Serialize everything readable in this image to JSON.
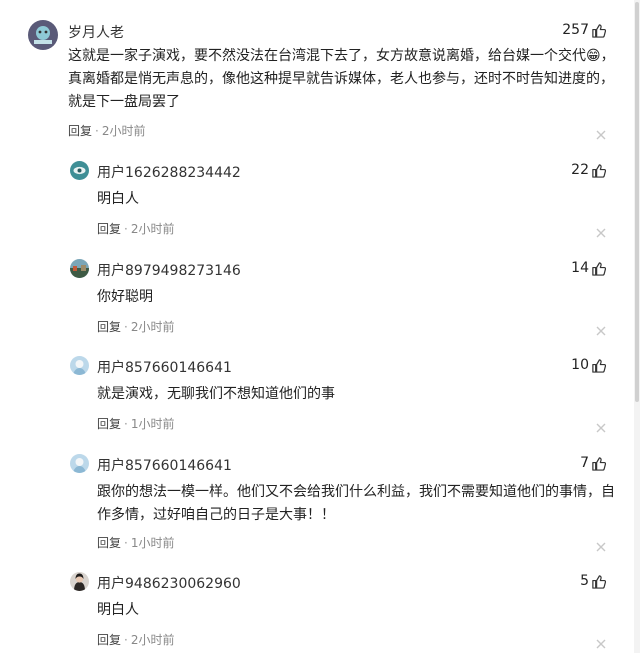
{
  "comments": [
    {
      "user": "岁月人老",
      "likes": "257",
      "content": "这就是一家子演戏，要不然没法在台湾混下去了，女方故意说离婚，给台媒一个交代😁，真离婚都是悄无声息的，像他这种提早就告诉媒体，老人也参与，还时不时告知进度的，就是下一盘局罢了",
      "reply_label": "回复",
      "time": "2小时前"
    },
    {
      "user": "用户1626288234442",
      "likes": "22",
      "content": "明白人",
      "reply_label": "回复",
      "time": "2小时前"
    },
    {
      "user": "用户8979498273146",
      "likes": "14",
      "content": "你好聪明",
      "reply_label": "回复",
      "time": "2小时前"
    },
    {
      "user": "用户857660146641",
      "likes": "10",
      "content": "就是演戏，无聊我们不想知道他们的事",
      "reply_label": "回复",
      "time": "1小时前"
    },
    {
      "user": "用户857660146641",
      "likes": "7",
      "content": "跟你的想法一模一样。他们又不会给我们什么利益，我们不需要知道他们的事情，自作多情，过好咱自己的日子是大事！！",
      "reply_label": "回复",
      "time": "1小时前"
    },
    {
      "user": "用户9486230062960",
      "likes": "5",
      "content": "明白人",
      "reply_label": "回复",
      "time": "2小时前"
    }
  ],
  "icons": {
    "like": "thumb-up-icon",
    "close": "close-icon"
  },
  "colors": {
    "text": "#222222",
    "meta": "#888888",
    "close": "#c8c8c8"
  }
}
